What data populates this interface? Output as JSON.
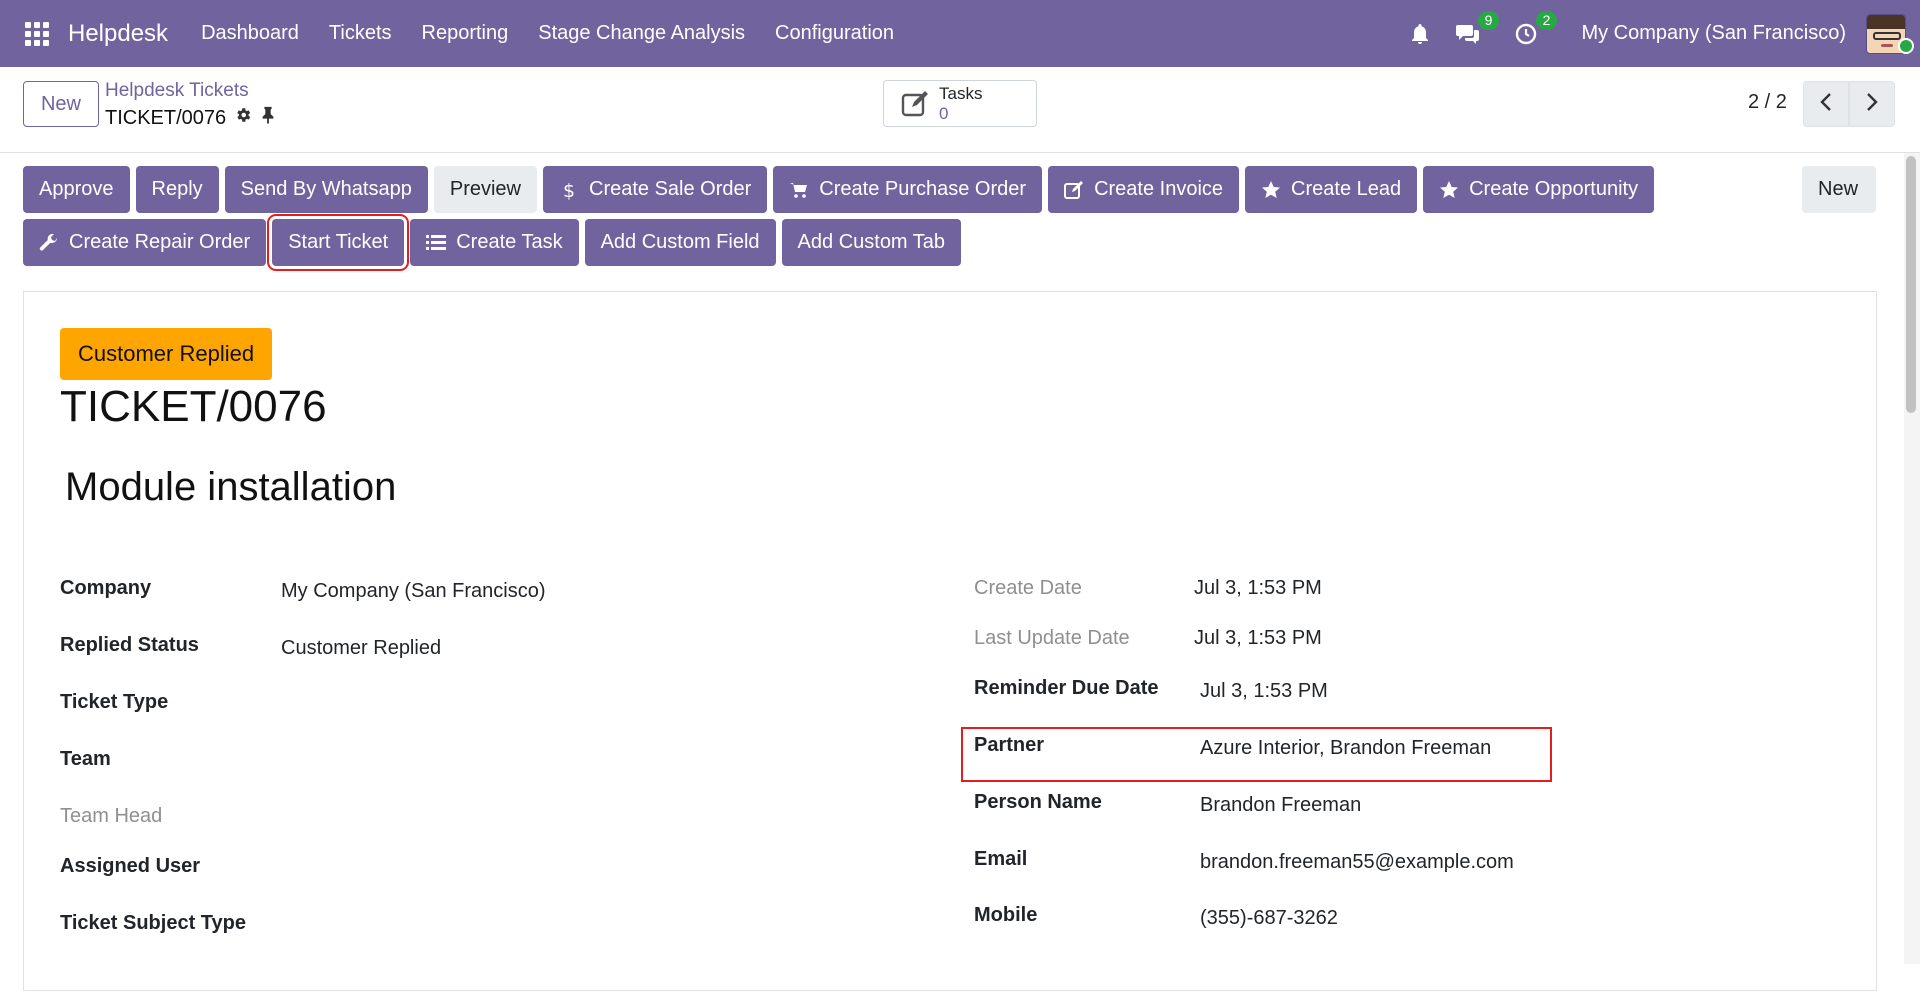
{
  "navbar": {
    "brand": "Helpdesk",
    "menus": [
      "Dashboard",
      "Tickets",
      "Reporting",
      "Stage Change Analysis",
      "Configuration"
    ],
    "chat_count": "9",
    "activity_count": "2",
    "company": "My Company (San Francisco)"
  },
  "control_panel": {
    "new_label": "New",
    "breadcrumb": "Helpdesk Tickets",
    "record": "TICKET/0076",
    "tasks_label": "Tasks",
    "tasks_count": "0",
    "pager": "2 / 2"
  },
  "header_buttons": {
    "row1": [
      "Approve",
      "Reply",
      "Send By Whatsapp",
      "Preview",
      "Create Sale Order",
      "Create Purchase Order",
      "Create Invoice",
      "Create Lead",
      "Create Opportunity"
    ],
    "new": "New",
    "row2": [
      "Create Repair Order",
      "Start Ticket",
      "Create Task",
      "Add Custom Field",
      "Add Custom Tab"
    ]
  },
  "sheet": {
    "stage": "Customer Replied",
    "name": "TICKET/0076",
    "subject": "Module installation",
    "left_fields": [
      {
        "label": "Company",
        "value": "My Company (San Francisco)"
      },
      {
        "label": "Replied Status",
        "value": "Customer Replied"
      },
      {
        "label": "Ticket Type",
        "value": ""
      },
      {
        "label": "Team",
        "value": ""
      },
      {
        "label": "Team Head",
        "value": ""
      },
      {
        "label": "Assigned User",
        "value": ""
      },
      {
        "label": "Ticket Subject Type",
        "value": ""
      }
    ],
    "right_fields": [
      {
        "label": "Create Date",
        "value": "Jul 3, 1:53 PM"
      },
      {
        "label": "Last Update Date",
        "value": "Jul 3, 1:53 PM"
      },
      {
        "label": "Reminder Due Date",
        "value": "Jul 3, 1:53 PM"
      },
      {
        "label": "Partner",
        "value": "Azure Interior, Brandon Freeman"
      },
      {
        "label": "Person Name",
        "value": "Brandon Freeman"
      },
      {
        "label": "Email",
        "value": "brandon.freeman55@example.com"
      },
      {
        "label": "Mobile",
        "value": "(355)-687-3262"
      }
    ]
  },
  "colors": {
    "brand": "#71639e",
    "stage_badge": "#ffa500",
    "highlight": "#e41d1d",
    "badge": "#28a745"
  }
}
